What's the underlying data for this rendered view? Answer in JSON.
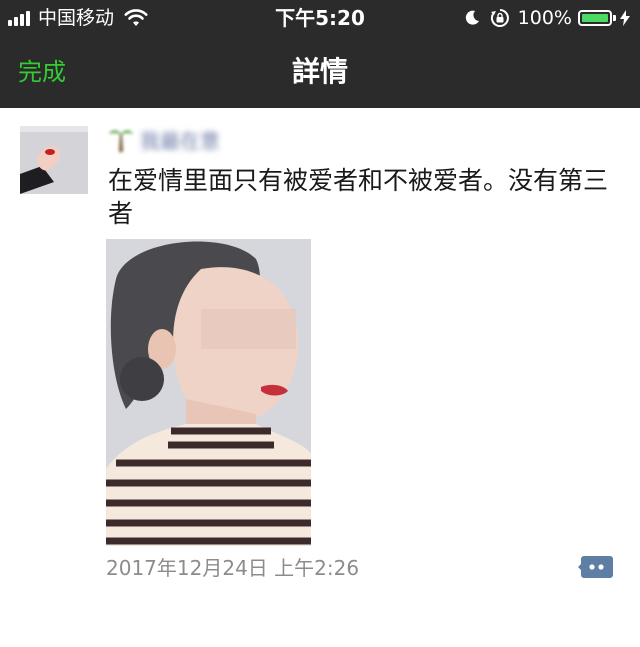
{
  "status_bar": {
    "carrier": "中国移动",
    "time": "下午5:20",
    "battery_percent": "100%",
    "icons": [
      "signal-icon",
      "wifi-icon",
      "moon-icon",
      "orientation-lock-icon",
      "battery-icon",
      "charging-icon"
    ]
  },
  "nav": {
    "done_label": "完成",
    "title": "詳情"
  },
  "post": {
    "username": "我最在意",
    "text": "在爱情里面只有被爱者和不被爱者。没有第三者",
    "timestamp": "2017年12月24日 上午2:26",
    "comment_icon": "comment-dots-icon"
  },
  "colors": {
    "bar_background": "#2b2b2b",
    "accent_green": "#33cc33",
    "battery_green": "#4cd964",
    "username_blue": "#6b7aa6",
    "timestamp_gray": "#8c8c8c"
  }
}
